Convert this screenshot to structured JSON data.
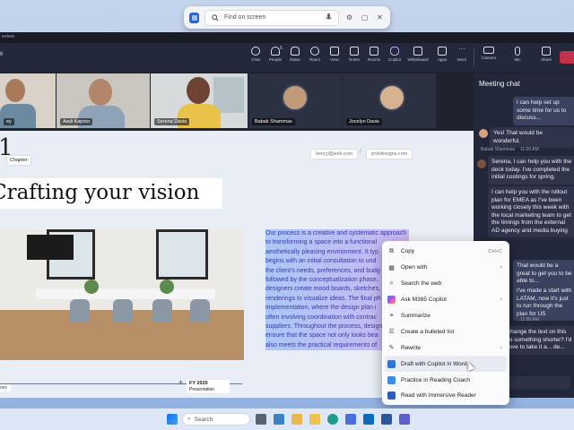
{
  "find_bar": {
    "placeholder": "Find on screen",
    "icons": [
      "app-icon",
      "search-icon",
      "mic-icon",
      "settings-icon",
      "window-icon",
      "close-icon"
    ]
  },
  "window": {
    "title_fragment": "eview",
    "meeting_label_fragment": "6",
    "toolbar": [
      {
        "label": "Chat",
        "icon": "chat-icon"
      },
      {
        "label": "People",
        "icon": "people-icon",
        "count": "6"
      },
      {
        "label": "Raise",
        "icon": "raise-hand-icon"
      },
      {
        "label": "React",
        "icon": "react-icon"
      },
      {
        "label": "View",
        "icon": "view-icon"
      },
      {
        "label": "Notes",
        "icon": "notes-icon"
      },
      {
        "label": "Rooms",
        "icon": "rooms-icon"
      },
      {
        "label": "Copilot",
        "icon": "copilot-icon"
      },
      {
        "label": "Whiteboard",
        "icon": "whiteboard-icon"
      },
      {
        "label": "Apps",
        "icon": "apps-icon"
      },
      {
        "label": "More",
        "icon": "more-icon"
      },
      {
        "label": "Camera",
        "icon": "camera-icon"
      },
      {
        "label": "Mic",
        "icon": "mic-icon"
      },
      {
        "label": "Share",
        "icon": "share-icon"
      }
    ]
  },
  "participants": [
    {
      "name": "ey"
    },
    {
      "name": "Aadi Kapoor"
    },
    {
      "name": "Serena Davis"
    },
    {
      "name": "Babak Shammas"
    },
    {
      "name": "Jocelyn Davis"
    }
  ],
  "stage": {
    "chapter_big": "1",
    "chapter_label": "Chapter",
    "email1": "henry@jesit.com",
    "email2": "jeviidesigns.com",
    "heading": "Crafting your vision",
    "paragraph_lines": [
      "Our process is a creative and systematic approach",
      "to transforming a space into a functional",
      "aesthetically pleasing environment. It typ",
      "begins with an initial consultation to und",
      "the client's needs, preferences, and budg",
      "followed by the conceptualization phase,",
      "designers create mood boards, sketches,",
      "renderings to visualize ideas. The final ph",
      "implementation, where the design plan i",
      "often involving coordination with contrac",
      "suppliers. Throughout the process, design",
      "ensure that the space not only looks bea",
      "also meets the practical requirements of"
    ],
    "timeline_left_label": "ney",
    "fy_title": "FY 2020",
    "fy_sub": "Presentation"
  },
  "chat": {
    "title": "Meeting chat",
    "messages": [
      {
        "text": "I can help set up some time for us to discuss...",
        "self": true
      },
      {
        "text": "Yes! That would be wonderful.",
        "self": false
      },
      {
        "sender": "Babak Shammas",
        "time": "11:00 AM"
      },
      {
        "text": "Serena, I can help you with the deck today. I've completed the initial costings for spring.",
        "mention": "Serena"
      },
      {
        "text": "I can help you with the rollout plan for EMEA as I've been working closely this week with the local marketing team to get the timings from the external AD agency and media buying"
      },
      {
        "text": "That would be a great to get you to be able to..."
      },
      {
        "text": "I've made a start with LATAM, now it's just to run through the plan for US"
      },
      {
        "time": "11:00 AM"
      },
      {
        "text": "change the text on this to something shorter? I'd love to take it a... de..."
      }
    ],
    "compose_placeholder": "message"
  },
  "context_menu": {
    "items": [
      {
        "label": "Copy",
        "shortcut": "Ctrl+C",
        "icon": "copy-icon"
      },
      {
        "label": "Open with",
        "submenu": true,
        "icon": "open-with-icon"
      },
      {
        "label": "Search the web",
        "icon": "web-search-icon"
      },
      {
        "label": "Ask M365 Copilot",
        "submenu": true,
        "icon": "copilot-icon"
      },
      {
        "label": "Summarize",
        "icon": "summarize-icon"
      },
      {
        "label": "Create a bulleted list",
        "icon": "bulleted-list-icon"
      },
      {
        "label": "Rewrite",
        "submenu": true,
        "icon": "rewrite-icon"
      },
      {
        "label": "Draft with Copilot in Word",
        "icon": "word-icon",
        "selected": true
      },
      {
        "label": "Practice in Reading Coach",
        "icon": "reading-coach-icon"
      },
      {
        "label": "Read with Immersive Reader",
        "icon": "immersive-reader-icon"
      }
    ]
  },
  "taskbar": {
    "search_placeholder": "Search",
    "icons": [
      "start-icon",
      "search-icon",
      "task-view-icon",
      "widgets-icon",
      "file-explorer-icon",
      "edge-icon",
      "store-icon",
      "outlook-icon",
      "word-icon",
      "teams-icon"
    ]
  }
}
